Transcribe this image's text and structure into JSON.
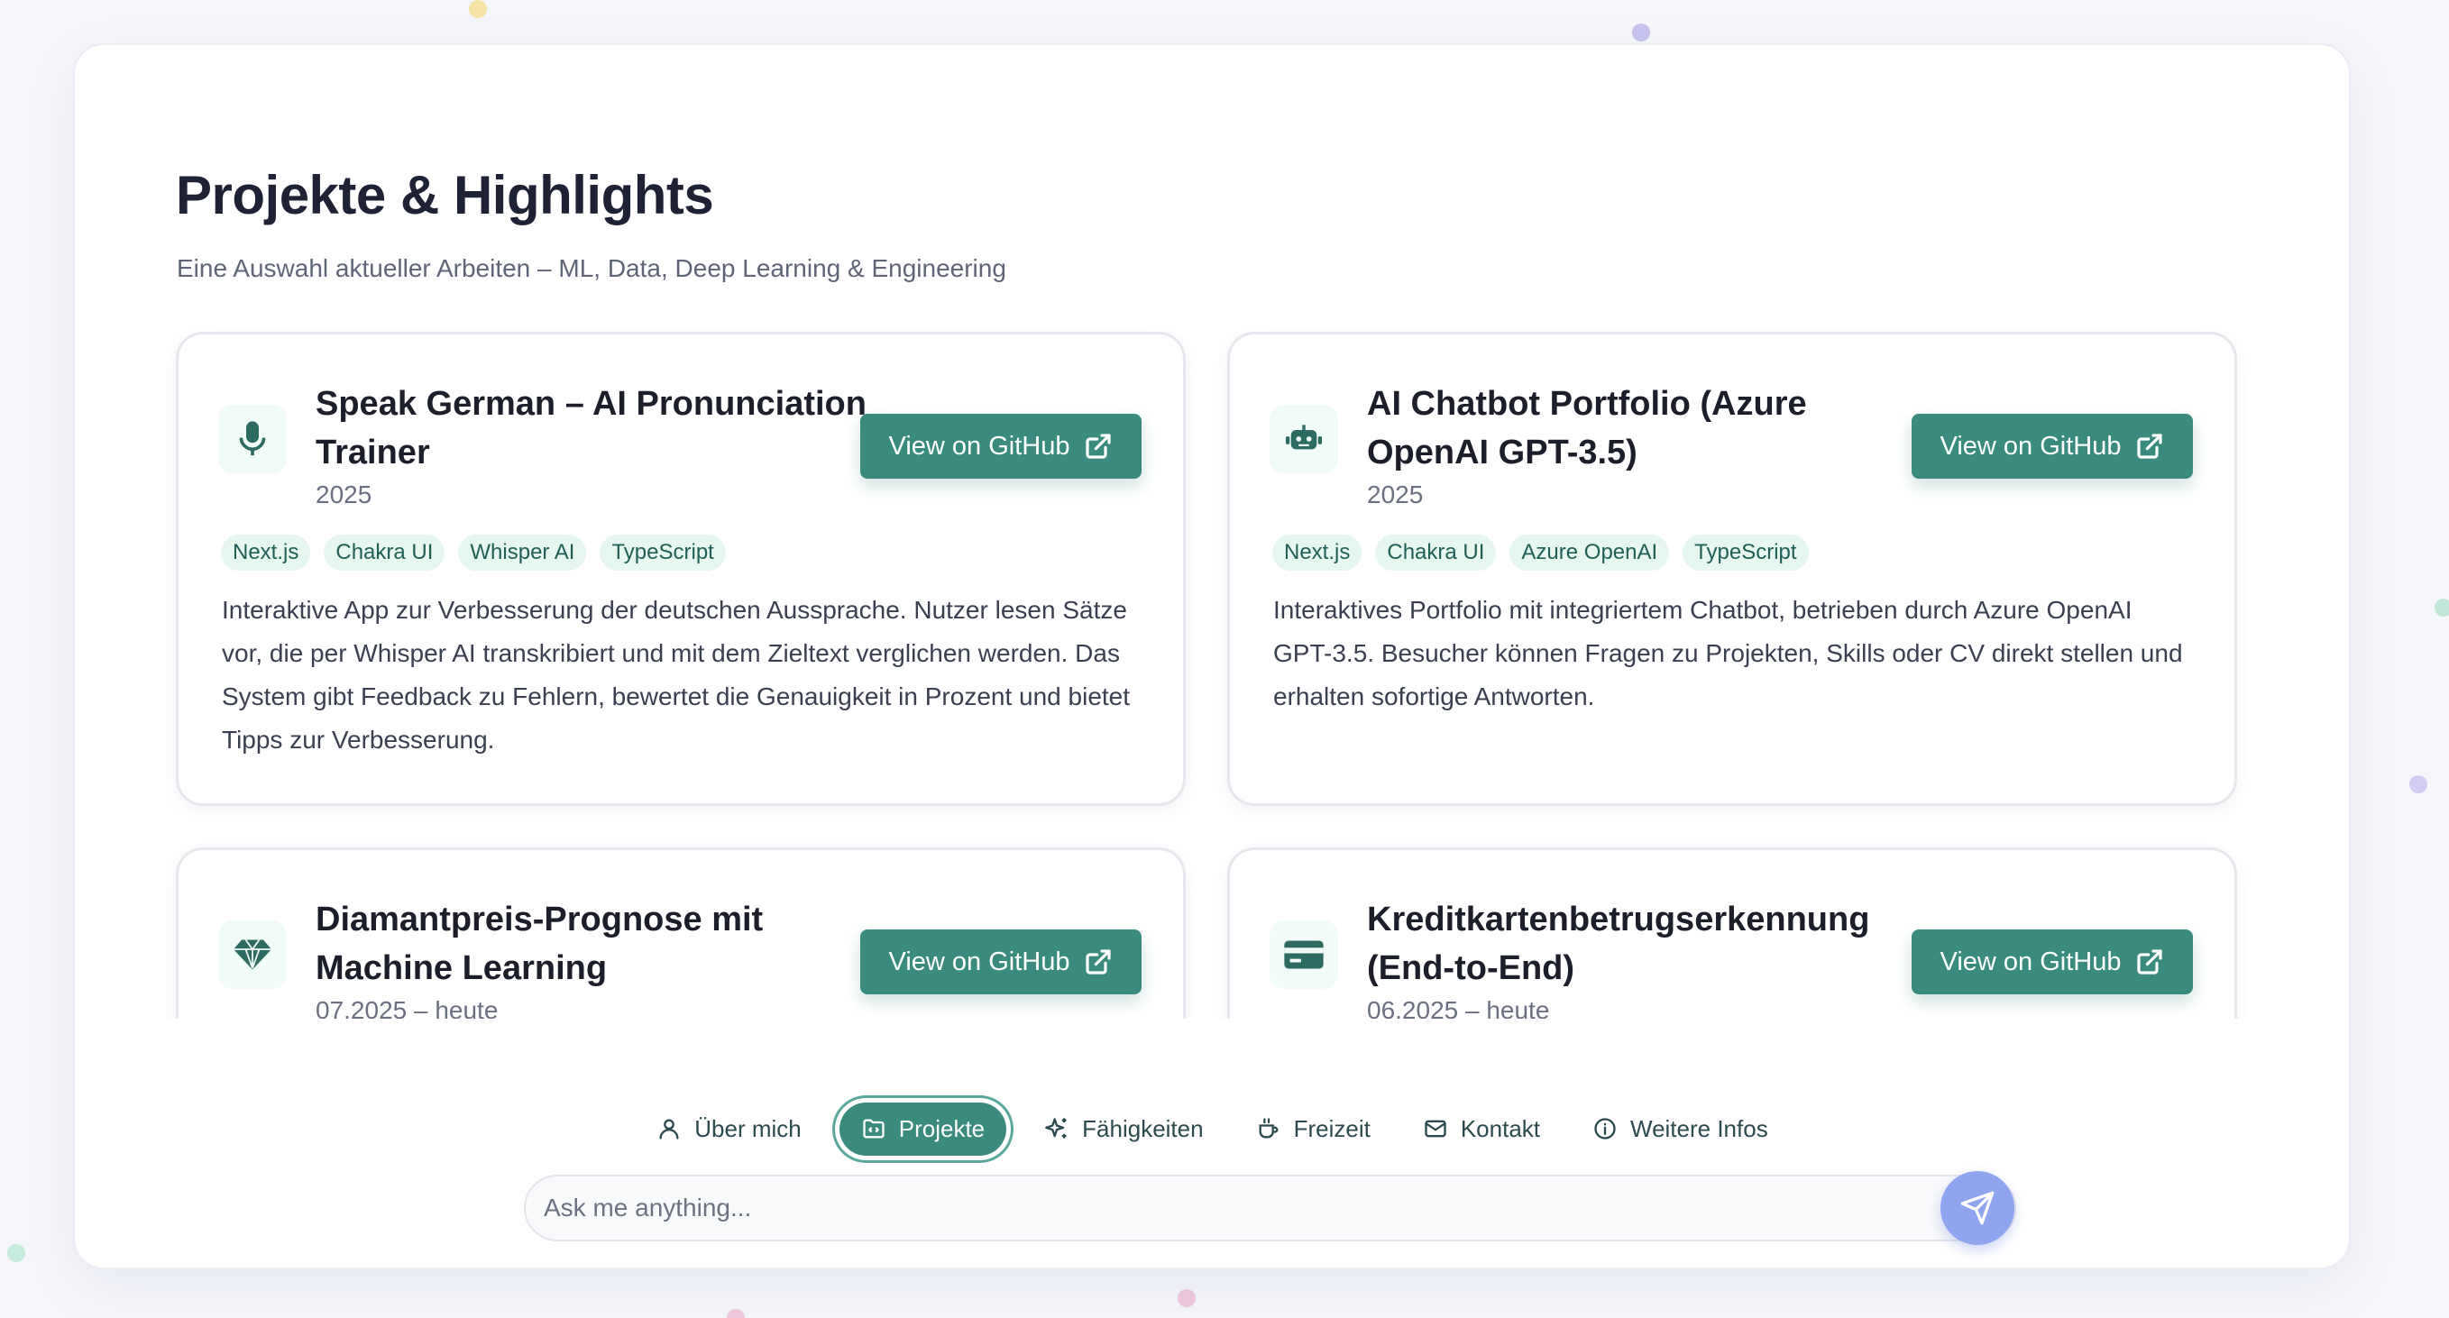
{
  "header": {
    "title": "Projekte & Highlights",
    "subtitle": "Eine Auswahl aktueller Arbeiten – ML, Data, Deep Learning & Engineering"
  },
  "projects": [
    {
      "icon": "microphone-icon",
      "title": "Speak German – AI Pronunciation Trainer",
      "year": "2025",
      "button_label": "View on GitHub",
      "tags": [
        "Next.js",
        "Chakra UI",
        "Whisper AI",
        "TypeScript"
      ],
      "description": "Interaktive App zur Verbesserung der deutschen Aussprache. Nutzer lesen Sätze vor, die per Whisper AI transkribiert und mit dem Zieltext verglichen werden. Das System gibt Feedback zu Fehlern, bewertet die Genauigkeit in Prozent und bietet Tipps zur Verbesserung."
    },
    {
      "icon": "robot-icon",
      "title": "AI Chatbot Portfolio (Azure OpenAI GPT-3.5)",
      "year": "2025",
      "button_label": "View on GitHub",
      "tags": [
        "Next.js",
        "Chakra UI",
        "Azure OpenAI",
        "TypeScript"
      ],
      "description": "Interaktives Portfolio mit integriertem Chatbot, betrieben durch Azure OpenAI GPT-3.5. Besucher können Fragen zu Projekten, Skills oder CV direkt stellen und erhalten sofortige Antworten."
    },
    {
      "icon": "diamond-icon",
      "title": "Diamantpreis-Prognose mit Machine Learning",
      "year": "07.2025 – heute",
      "button_label": "View on GitHub",
      "tags": [],
      "description": ""
    },
    {
      "icon": "credit-card-icon",
      "title": "Kreditkartenbetrugserkennung (End-to-End)",
      "year": "06.2025 – heute",
      "button_label": "View on GitHub",
      "tags": [],
      "description": ""
    }
  ],
  "nav": {
    "items": [
      {
        "label": "Über mich",
        "icon": "user-icon"
      },
      {
        "label": "Projekte",
        "icon": "folder-code-icon",
        "active": true
      },
      {
        "label": "Fähigkeiten",
        "icon": "sparkles-icon"
      },
      {
        "label": "Freizeit",
        "icon": "coffee-icon"
      },
      {
        "label": "Kontakt",
        "icon": "mail-icon"
      },
      {
        "label": "Weitere Infos",
        "icon": "info-icon"
      }
    ]
  },
  "chat": {
    "placeholder": "Ask me anything...",
    "value": ""
  },
  "colors": {
    "accent": "#3b8a7e",
    "tag_bg": "#e5f7ef",
    "send_button": "#8fa5f0"
  }
}
